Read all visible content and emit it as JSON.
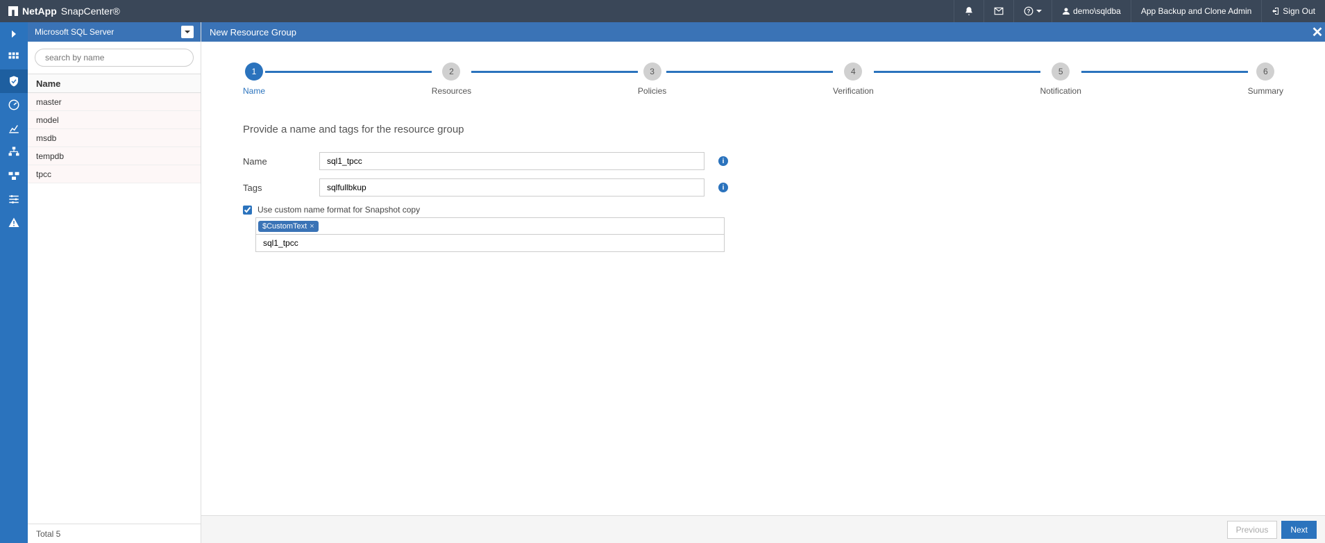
{
  "brand": {
    "company": "NetApp",
    "product": "SnapCenter®"
  },
  "topbar": {
    "user": "demo\\sqldba",
    "role": "App Backup and Clone Admin",
    "signout": "Sign Out"
  },
  "sidebar": {
    "plugin": "Microsoft SQL Server",
    "search_placeholder": "search by name",
    "column_header": "Name",
    "items": [
      "master",
      "model",
      "msdb",
      "tempdb",
      "tpcc"
    ],
    "footer": "Total 5"
  },
  "main": {
    "title": "New Resource Group",
    "wizard_steps": [
      {
        "num": "1",
        "label": "Name",
        "active": true
      },
      {
        "num": "2",
        "label": "Resources",
        "active": false
      },
      {
        "num": "3",
        "label": "Policies",
        "active": false
      },
      {
        "num": "4",
        "label": "Verification",
        "active": false
      },
      {
        "num": "5",
        "label": "Notification",
        "active": false
      },
      {
        "num": "6",
        "label": "Summary",
        "active": false
      }
    ],
    "section_title": "Provide a name and tags for the resource group",
    "form": {
      "name_label": "Name",
      "name_value": "sql1_tpcc",
      "tags_label": "Tags",
      "tags_value": "sqlfullbkup",
      "checkbox_label": "Use custom name format for Snapshot copy",
      "checkbox_checked": true,
      "tag_pill": "$CustomText",
      "snapshot_value": "sql1_tpcc"
    },
    "footer": {
      "prev": "Previous",
      "next": "Next"
    }
  }
}
